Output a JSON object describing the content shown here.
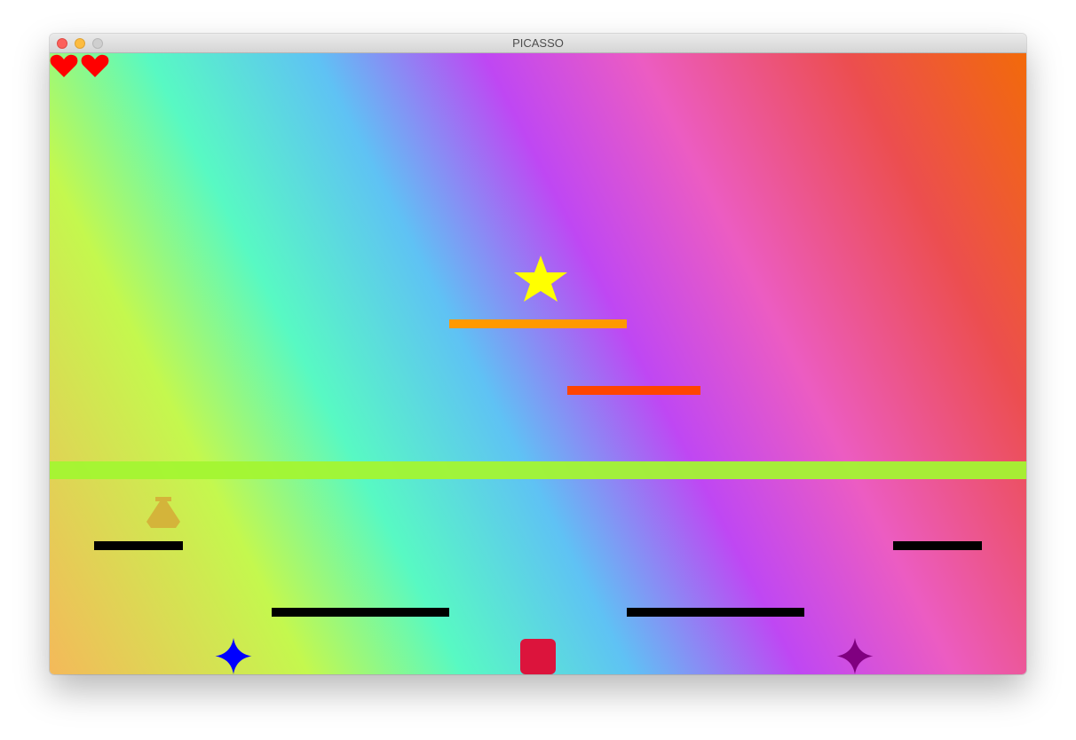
{
  "window": {
    "title": "PICASSO",
    "controls": [
      "close",
      "minimize",
      "zoom"
    ]
  },
  "hud": {
    "lives": 2,
    "life_icon": "heart-icon",
    "life_color": "#ff0000"
  },
  "level": {
    "background": "rainbow-gradient",
    "collectibles": [
      {
        "name": "star",
        "color": "#ffff00"
      },
      {
        "name": "flask-pot",
        "color": "#d4b43a"
      }
    ],
    "players": [
      {
        "name": "blue-player",
        "color": "#0000ff"
      },
      {
        "name": "red-player",
        "color": "#dc143c"
      },
      {
        "name": "purple-player",
        "color": "#800080"
      }
    ],
    "platforms": [
      {
        "name": "orange-platform",
        "color": "#ff9900"
      },
      {
        "name": "red-orange-platform",
        "color": "#ff4500"
      },
      {
        "name": "green-ground",
        "color": "#a3f532"
      },
      {
        "name": "black-platform",
        "color": "#000000"
      }
    ]
  }
}
